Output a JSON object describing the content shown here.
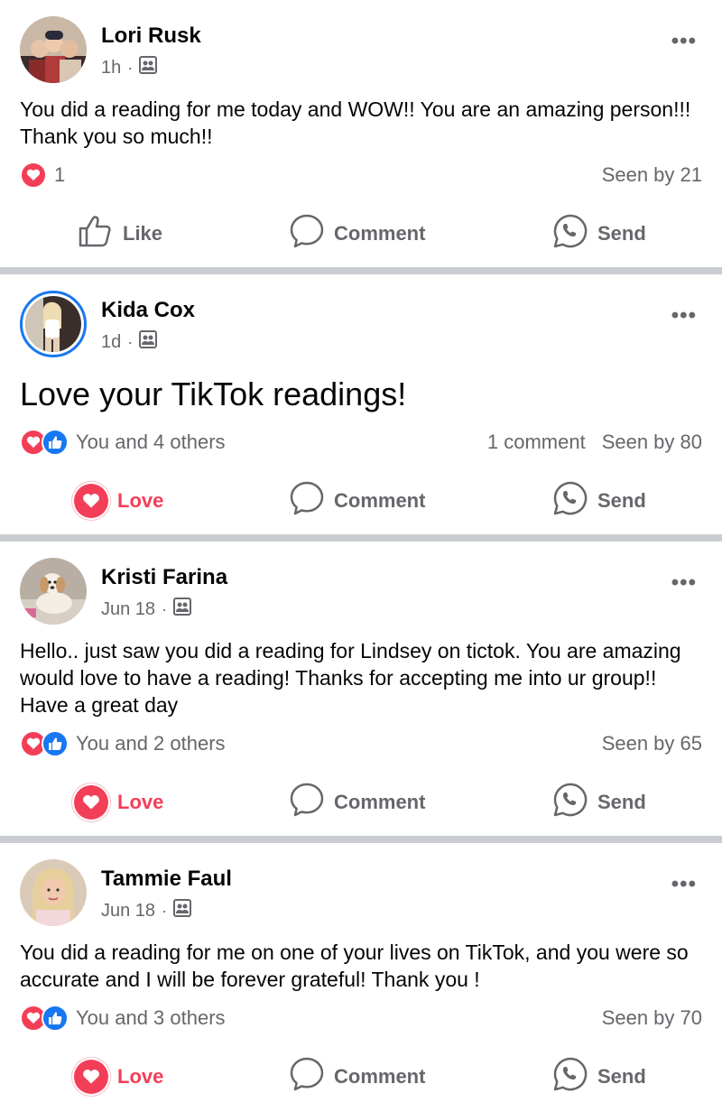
{
  "colors": {
    "love": "#f33e58",
    "like": "#1877f2",
    "muted": "#65676b",
    "divider": "#c9ccd1"
  },
  "posts": [
    {
      "author": "Lori Rusk",
      "time": "1h",
      "privacy_icon": "group-members-icon",
      "text": "You did a reading for me today and WOW!! You are an amazing person!!! Thank you so much!!",
      "reaction_summary": "1",
      "comments": "",
      "seen": "Seen by 21",
      "actions": {
        "react": "Like",
        "comment": "Comment",
        "send": "Send"
      }
    },
    {
      "author": "Kida Cox",
      "time": "1d",
      "privacy_icon": "group-members-icon",
      "text": "Love your TikTok readings!",
      "reaction_summary": "You and 4 others",
      "comments": "1 comment",
      "seen": "Seen by 80",
      "actions": {
        "react": "Love",
        "comment": "Comment",
        "send": "Send"
      }
    },
    {
      "author": "Kristi Farina",
      "time": "Jun 18",
      "privacy_icon": "group-members-icon",
      "text": "Hello.. just saw you did a reading for Lindsey on tictok. You are amazing would love to have a reading! Thanks for accepting me into ur group!! Have a great day",
      "reaction_summary": "You and 2 others",
      "comments": "",
      "seen": "Seen by 65",
      "actions": {
        "react": "Love",
        "comment": "Comment",
        "send": "Send"
      }
    },
    {
      "author": "Tammie Faul",
      "time": "Jun 18",
      "privacy_icon": "group-members-icon",
      "text": "You did a reading for me on one of your lives on TikTok, and you were so accurate and I will be forever grateful! Thank you !",
      "reaction_summary": "You and 3 others",
      "comments": "",
      "seen": "Seen by 70",
      "actions": {
        "react": "Love",
        "comment": "Comment",
        "send": "Send"
      }
    }
  ]
}
